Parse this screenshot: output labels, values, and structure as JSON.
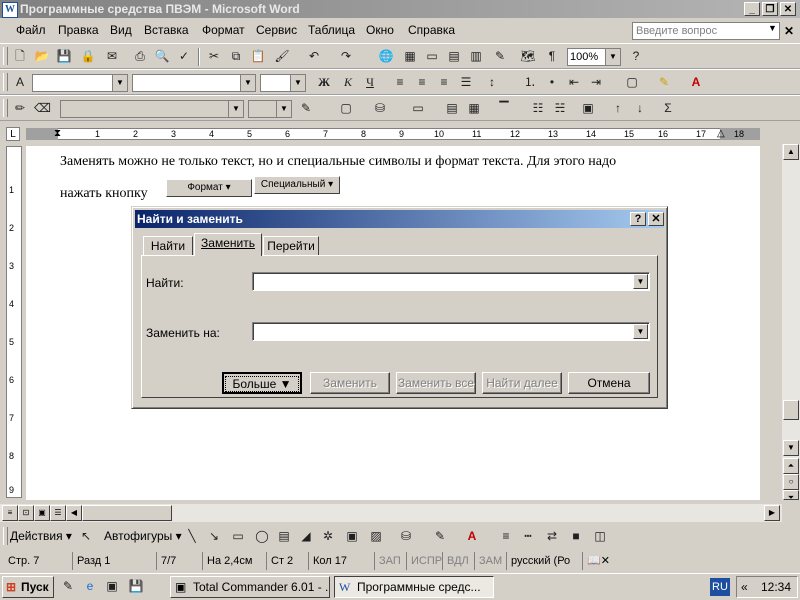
{
  "window": {
    "title": "Программные средства ПВЭМ - Microsoft Word"
  },
  "menu": {
    "items": [
      "Файл",
      "Правка",
      "Вид",
      "Вставка",
      "Формат",
      "Сервис",
      "Таблица",
      "Окно",
      "Справка"
    ],
    "ask_placeholder": "Введите вопрос"
  },
  "toolbar": {
    "zoom": "100%"
  },
  "ruler": {
    "numbers": [
      "1",
      "2",
      "3",
      "4",
      "5",
      "6",
      "7",
      "8",
      "9",
      "10",
      "11",
      "12",
      "13",
      "14",
      "15",
      "16",
      "17",
      "18"
    ],
    "vnumbers": [
      "1",
      "2",
      "3",
      "4",
      "5",
      "6",
      "7",
      "8",
      "9"
    ]
  },
  "document": {
    "line1": "Заменять можно не только текст, но и специальные символы и формат текста. Для этого надо",
    "line2": "нажать кнопку",
    "btn_format": "Формат",
    "btn_special": "Специальный"
  },
  "dialog": {
    "title": "Найти и заменить",
    "help": "?",
    "close": "✕",
    "tabs": [
      "Найти",
      "Заменить",
      "Перейти"
    ],
    "find_label": "Найти:",
    "find_value": "",
    "replace_label": "Заменить на:",
    "replace_value": "",
    "buttons": {
      "more": "Больше ▼",
      "replace": "Заменить",
      "replace_all": "Заменить все",
      "find_next": "Найти далее",
      "cancel": "Отмена"
    }
  },
  "drawing": {
    "actions": "Действия",
    "autoshapes": "Автофигуры"
  },
  "status": {
    "page": "Стр. 7",
    "section": "Разд 1",
    "pages": "7/7",
    "at": "На 2,4см",
    "line": "Ст 2",
    "col": "Кол 17",
    "rec": "ЗАП",
    "trk": "ИСПР",
    "ext": "ВДЛ",
    "ovr": "ЗАМ",
    "lang": "русский (Ро"
  },
  "taskbar": {
    "start": "Пуск",
    "tasks": [
      "Total Commander 6.01 - ...",
      "Программные средс..."
    ],
    "lang": "RU",
    "time": "12:34"
  }
}
